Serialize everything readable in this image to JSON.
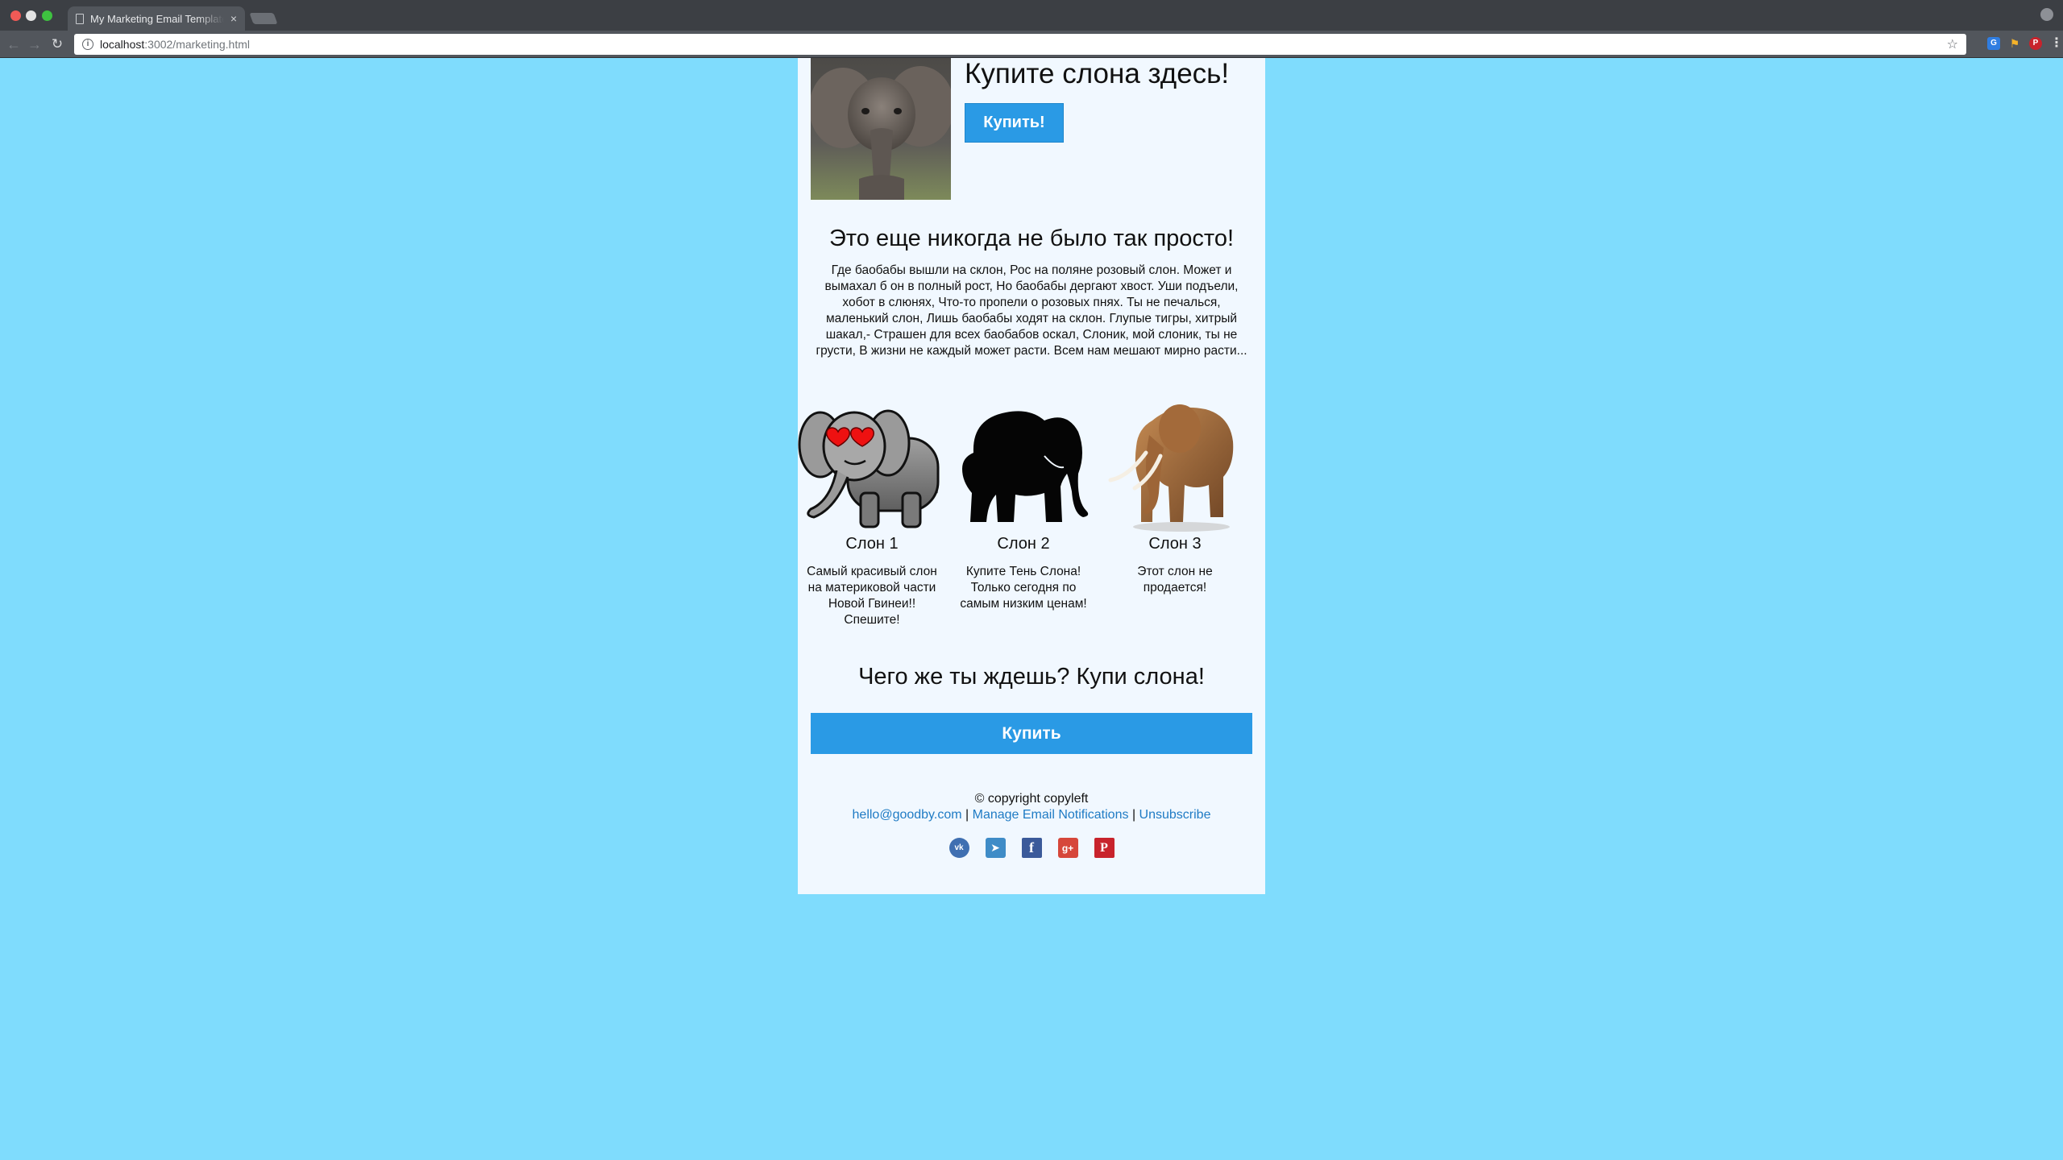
{
  "browser": {
    "tab_title": "My Marketing Email Template",
    "tab_close": "×",
    "url_host": "localhost",
    "url_path": ":3002/marketing.html",
    "info_glyph": "i",
    "star_glyph": "☆"
  },
  "hero": {
    "title": "Купите слона здесь!",
    "button": "Купить!",
    "image_icon": "baby-elephant-photo"
  },
  "headline": "Это еще никогда не было так просто!",
  "intro": "Где баобабы вышли на склон, Рос на поляне розовый слон. Может и вымахал б он в полный рост, Но баобабы дергают хвост. Уши подъели, хобот в слюнях, Что-то пропели о розовых пнях. Ты не печалься, маленький слон, Лишь баобабы ходят на склон. Глупые тигры, хитрый шакал,- Страшен для всех баобабов оскал, Слоник, мой слоник, ты не грусти, В жизни не каждый может расти. Всем нам мешают мирно расти...",
  "products": [
    {
      "name": "Слон 1",
      "desc": "Самый красивый слон на материковой части Новой Гвинеи!! Спешите!",
      "icon": "cartoon-elephant-heart-eyes"
    },
    {
      "name": "Слон 2",
      "desc": "Купите Тень Слона! Только сегодня по самым низким ценам!",
      "icon": "elephant-silhouette"
    },
    {
      "name": "Слон 3",
      "desc": "Этот слон не продается!",
      "icon": "realistic-elephant"
    }
  ],
  "cta": {
    "title": "Чего же ты ждешь? Купи слона!",
    "button": "Купить"
  },
  "footer": {
    "copyright": "© copyright copyleft",
    "email": "hello@goodby.com",
    "separator": "|",
    "manage": "Manage Email Notifications",
    "unsubscribe": "Unsubscribe"
  },
  "social": [
    {
      "name": "vk",
      "glyph": "vk",
      "color": "#3f6fb1"
    },
    {
      "name": "telegram",
      "glyph": "➤",
      "color": "#3f8cc7"
    },
    {
      "name": "facebook",
      "glyph": "f",
      "color": "#3b5a9a"
    },
    {
      "name": "google-plus",
      "glyph": "g+",
      "color": "#d6473a"
    },
    {
      "name": "pinterest",
      "glyph": "P",
      "color": "#c8232c"
    }
  ],
  "colors": {
    "page_bg": "#7fdcfd",
    "email_bg": "#f1f8ff",
    "button": "#2a9ae5",
    "link": "#1f7bc4"
  }
}
